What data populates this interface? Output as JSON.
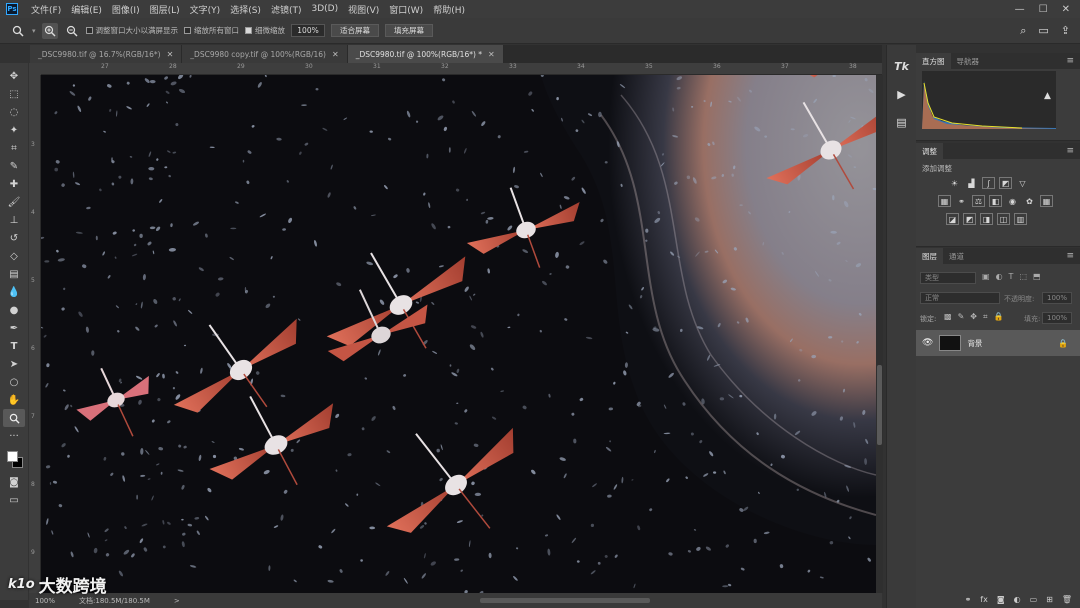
{
  "menubar": {
    "items": [
      "文件(F)",
      "编辑(E)",
      "图像(I)",
      "图层(L)",
      "文字(Y)",
      "选择(S)",
      "滤镜(T)",
      "3D(D)",
      "视图(V)",
      "窗口(W)",
      "帮助(H)"
    ],
    "logo": "Ps",
    "window_controls": [
      "—",
      "☐",
      "✕"
    ]
  },
  "options": {
    "chk_resize": "调整窗口大小以满屏显示",
    "chk_all_windows": "缩放所有窗口",
    "chk_scrubby": "细微缩放",
    "zoom_value": "100%",
    "fit_screen": "适合屏幕",
    "fill_screen": "填充屏幕"
  },
  "tabs": [
    {
      "label": "_DSC9980.tif @ 16.7%(RGB/16*)",
      "close": "✕"
    },
    {
      "label": "_DSC9980 copy.tif @ 100%(RGB/16)",
      "close": "✕"
    },
    {
      "label": "_DSC9980.tif @ 100%(RGB/16*) *",
      "close": "✕"
    }
  ],
  "ruler": {
    "top": [
      "27",
      "28",
      "29",
      "30",
      "31",
      "32",
      "33",
      "34",
      "35",
      "36",
      "37",
      "38"
    ],
    "left": [
      "3",
      "4",
      "5",
      "6",
      "7",
      "8",
      "9"
    ]
  },
  "statusbar": {
    "zoom": "100%",
    "doc": "文档:180.5M/180.5M",
    "arrow": ">"
  },
  "watermark": {
    "logo": "k1o",
    "text": "大数跨境"
  },
  "panels": {
    "histogram_tab": "直方图",
    "navigator_tab": "导航器",
    "adjustments_tab": "调整",
    "adjustments_label": "添加调整",
    "layers_tab": "图层",
    "channels_tab": "通道",
    "kind_placeholder": "类型",
    "blend_mode": "正常",
    "opacity_label": "不透明度:",
    "opacity_value": "100%",
    "lock_label": "锁定:",
    "fill_label": "填充:",
    "fill_value": "100%",
    "layer_name": "背景"
  },
  "colors": {
    "accent": "#31a8ff",
    "flamingo": "#d9624a"
  }
}
